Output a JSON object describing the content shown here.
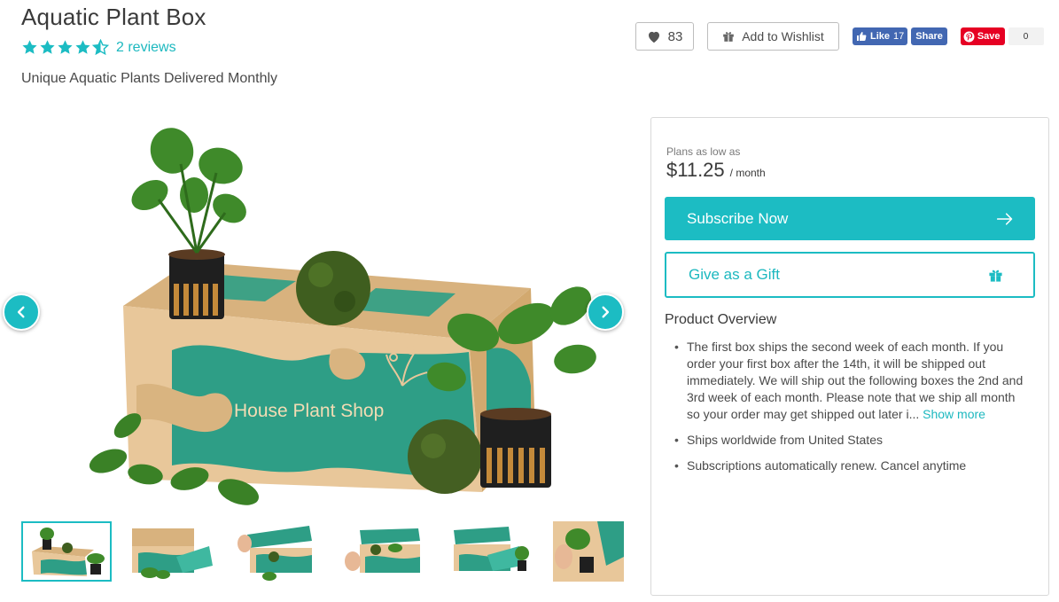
{
  "product": {
    "title": "Aquatic Plant Box",
    "rating_stars": 4.5,
    "reviews_link": "2 reviews",
    "subtitle": "Unique Aquatic Plants Delivered Monthly"
  },
  "actions": {
    "like_count": "83",
    "wishlist_label": "Add to Wishlist",
    "fb_like_label": "Like",
    "fb_like_count": "17",
    "fb_share_label": "Share",
    "pin_save_label": "Save",
    "pin_count": "0"
  },
  "gallery": {
    "box_text": "House Plant Shop",
    "thumbnail_count": 6,
    "active_thumbnail": 1
  },
  "pricing": {
    "plans_label": "Plans as low as",
    "price": "$11.25",
    "per": "/ month",
    "subscribe_label": "Subscribe Now",
    "gift_label": "Give as a Gift"
  },
  "overview": {
    "title": "Product Overview",
    "items": [
      "The first box ships the second week of each month. If you order your first box after the 14th, it will be shipped out immediately. We will ship out the following boxes the 2nd and 3rd week of each month. Please note that we ship all month so your order may get shipped out later i...",
      "Ships worldwide from United States",
      "Subscriptions automatically renew. Cancel anytime"
    ],
    "show_more": "Show more"
  },
  "colors": {
    "accent": "#1cbcc3",
    "box_green": "#2e9e86",
    "box_kraft": "#e8c79a",
    "facebook": "#4267b2",
    "pinterest": "#e60023"
  }
}
